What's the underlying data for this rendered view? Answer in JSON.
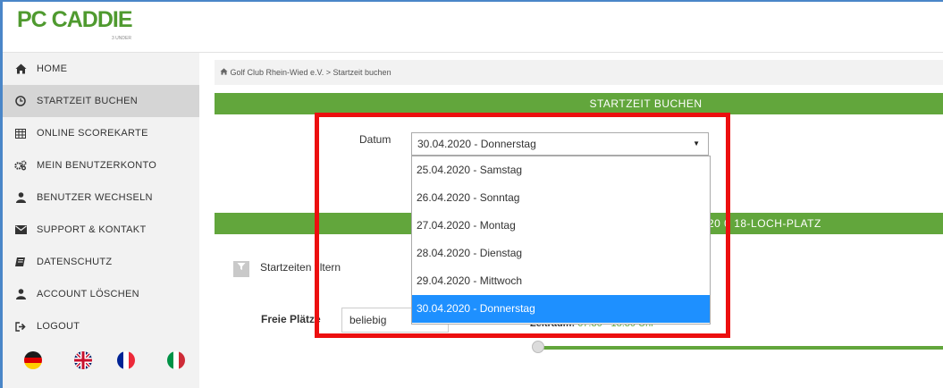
{
  "brand": {
    "logo_text": "PC CADDIE",
    "logo_sub": "3 UNDER"
  },
  "sidebar": {
    "items": [
      {
        "label": "HOME",
        "icon": "home-icon"
      },
      {
        "label": "STARTZEIT BUCHEN",
        "icon": "clock-icon",
        "active": true
      },
      {
        "label": "ONLINE SCOREKARTE",
        "icon": "table-icon"
      },
      {
        "label": "MEIN BENUTZERKONTO",
        "icon": "gears-icon"
      },
      {
        "label": "BENUTZER WECHSELN",
        "icon": "user-icon"
      },
      {
        "label": "SUPPORT & KONTAKT",
        "icon": "envelope-icon"
      },
      {
        "label": "DATENSCHUTZ",
        "icon": "book-icon"
      },
      {
        "label": "ACCOUNT LÖSCHEN",
        "icon": "user-icon"
      },
      {
        "label": "LOGOUT",
        "icon": "sign-out-icon"
      }
    ],
    "flags": [
      "german-flag-icon",
      "uk-flag-icon",
      "french-flag-icon",
      "italian-flag-icon"
    ]
  },
  "breadcrumb": {
    "club": "Golf Club Rhein-Wied e.V.",
    "separator": ">",
    "page": "Startzeit buchen"
  },
  "main": {
    "section_title": "STARTZEIT BUCHEN",
    "course_bar_text": "20 0 18-LOCH-PLATZ",
    "datum_label": "Datum",
    "datum_selected": "30.04.2020 - Donnerstag",
    "datum_options": [
      "25.04.2020 - Samstag",
      "26.04.2020 - Sonntag",
      "27.04.2020 - Montag",
      "28.04.2020 - Dienstag",
      "29.04.2020 - Mittwoch",
      "30.04.2020 - Donnerstag"
    ],
    "filter_label": "Startzeiten filtern",
    "freie_plaetze_label": "Freie Plätze",
    "freie_plaetze_value": "beliebig",
    "zeitraum_label": "Zeitraum:",
    "zeitraum_value": "07:30 - 18:30 Uhr"
  },
  "colors": {
    "green": "#62a63c",
    "highlight_red": "#ec0f0f",
    "selection_blue": "#1e90ff",
    "frame_blue": "#4a86c8"
  }
}
